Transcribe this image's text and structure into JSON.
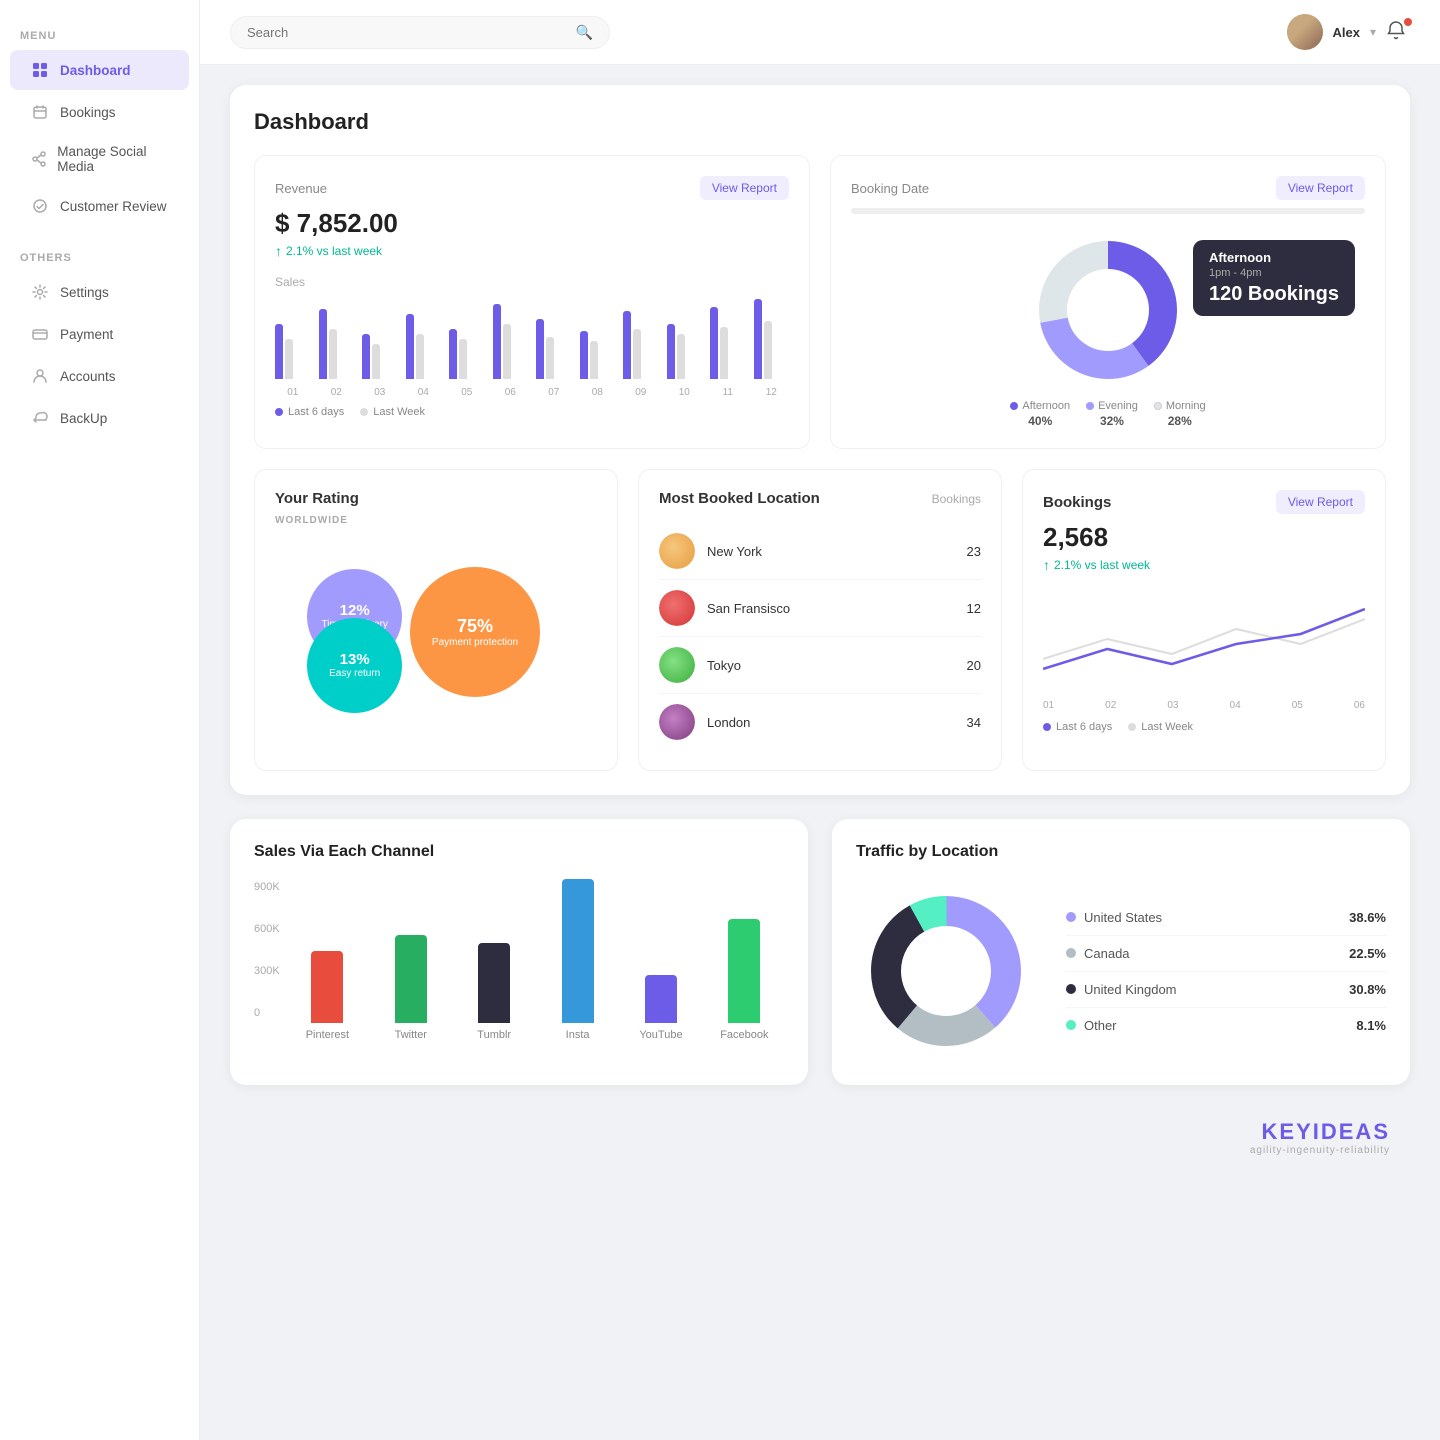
{
  "sidebar": {
    "menu_label": "MENU",
    "others_label": "OTHERS",
    "items": [
      {
        "label": "Dashboard",
        "active": true,
        "icon": "dashboard-icon"
      },
      {
        "label": "Bookings",
        "active": false,
        "icon": "bookings-icon"
      },
      {
        "label": "Manage Social Media",
        "active": false,
        "icon": "social-icon"
      },
      {
        "label": "Customer Review",
        "active": false,
        "icon": "review-icon"
      }
    ],
    "other_items": [
      {
        "label": "Settings",
        "icon": "settings-icon"
      },
      {
        "label": "Payment",
        "icon": "payment-icon"
      },
      {
        "label": "Accounts",
        "icon": "accounts-icon"
      },
      {
        "label": "BackUp",
        "icon": "backup-icon"
      }
    ]
  },
  "header": {
    "search_placeholder": "Search",
    "user_name": "Alex",
    "search_icon": "🔍"
  },
  "dashboard": {
    "title": "Dashboard",
    "revenue": {
      "label": "Revenue",
      "amount": "$ 7,852.00",
      "change": "2.1% vs last week",
      "view_report": "View Report",
      "sales_label": "Sales",
      "chart_labels": [
        "01",
        "02",
        "03",
        "04",
        "05",
        "06",
        "07",
        "08",
        "09",
        "10",
        "11",
        "12"
      ],
      "legend": [
        {
          "label": "Last 6 days",
          "color": "#6c5ce7"
        },
        {
          "label": "Last Week",
          "color": "#ddd"
        }
      ],
      "bars": [
        {
          "primary": 55,
          "secondary": 40
        },
        {
          "primary": 70,
          "secondary": 50
        },
        {
          "primary": 45,
          "secondary": 35
        },
        {
          "primary": 65,
          "secondary": 45
        },
        {
          "primary": 50,
          "secondary": 40
        },
        {
          "primary": 75,
          "secondary": 55
        },
        {
          "primary": 60,
          "secondary": 42
        },
        {
          "primary": 48,
          "secondary": 38
        },
        {
          "primary": 68,
          "secondary": 50
        },
        {
          "primary": 55,
          "secondary": 45
        },
        {
          "primary": 72,
          "secondary": 52
        },
        {
          "primary": 80,
          "secondary": 58
        }
      ]
    },
    "booking_date": {
      "label": "Booking Date",
      "view_report": "View Report",
      "tooltip": {
        "title": "Afternoon",
        "time": "1pm - 4pm",
        "count": "120 Bookings"
      },
      "segments": [
        {
          "label": "Afternoon",
          "pct": "40%",
          "color": "#6c5ce7",
          "value": 40
        },
        {
          "label": "Evening",
          "pct": "32%",
          "color": "#a29bfe",
          "value": 32
        },
        {
          "label": "Morning",
          "pct": "28%",
          "color": "#dfe6e9",
          "value": 28
        }
      ]
    },
    "rating": {
      "label": "Your Rating",
      "worldwide": "WORLDWIDE",
      "bubbles": [
        {
          "pct": "75%",
          "label": "Payment protection",
          "color": "#fd9644",
          "size": 130,
          "left": "50%",
          "top": "50%"
        },
        {
          "pct": "12%",
          "label": "Timely delivery",
          "color": "#a29bfe",
          "size": 95,
          "left": "25%",
          "top": "35%"
        },
        {
          "pct": "13%",
          "label": "Easy return",
          "color": "#00cec9",
          "size": 95,
          "left": "20%",
          "top": "65%"
        }
      ]
    },
    "most_booked": {
      "label": "Most Booked Location",
      "bookings_col": "Bookings",
      "locations": [
        {
          "name": "New York",
          "count": "23",
          "color": "#f39c12"
        },
        {
          "name": "San Fransisco",
          "count": "12",
          "color": "#e74c3c"
        },
        {
          "name": "Tokyo",
          "count": "20",
          "color": "#27ae60"
        },
        {
          "name": "London",
          "count": "34",
          "color": "#8e44ad"
        }
      ]
    },
    "bookings": {
      "label": "Bookings",
      "count": "2,568",
      "change": "2.1% vs last week",
      "view_report": "View Report",
      "chart_labels": [
        "01",
        "02",
        "03",
        "04",
        "05",
        "06"
      ],
      "legend": [
        {
          "label": "Last 6 days",
          "color": "#6c5ce7"
        },
        {
          "label": "Last Week",
          "color": "#ddd"
        }
      ]
    }
  },
  "channels": {
    "title": "Sales Via Each Channel",
    "y_labels": [
      "900K",
      "600K",
      "300K",
      "0"
    ],
    "bars": [
      {
        "label": "Pinterest",
        "color": "#e74c3c",
        "height_pct": 45
      },
      {
        "label": "Twitter",
        "color": "#27ae60",
        "height_pct": 55
      },
      {
        "label": "Tumblr",
        "color": "#2d2d3f",
        "height_pct": 50
      },
      {
        "label": "Insta",
        "color": "#3498db",
        "height_pct": 90
      },
      {
        "label": "YouTube",
        "color": "#6c5ce7",
        "height_pct": 30
      },
      {
        "label": "Facebook",
        "color": "#2ecc71",
        "height_pct": 65
      }
    ]
  },
  "traffic": {
    "title": "Traffic by Location",
    "segments": [
      {
        "label": "United States",
        "pct": "38.6%",
        "color": "#a29bfe",
        "value": 38.6
      },
      {
        "label": "Canada",
        "pct": "22.5%",
        "color": "#b2bec3",
        "value": 22.5
      },
      {
        "label": "United Kingdom",
        "pct": "30.8%",
        "color": "#2d2d3f",
        "value": 30.8
      },
      {
        "label": "Other",
        "pct": "8.1%",
        "color": "#55efc4",
        "value": 8.1
      }
    ]
  },
  "brand": {
    "name": "KEYIDEAS",
    "tagline": "agility-ingenuity-reliability"
  }
}
